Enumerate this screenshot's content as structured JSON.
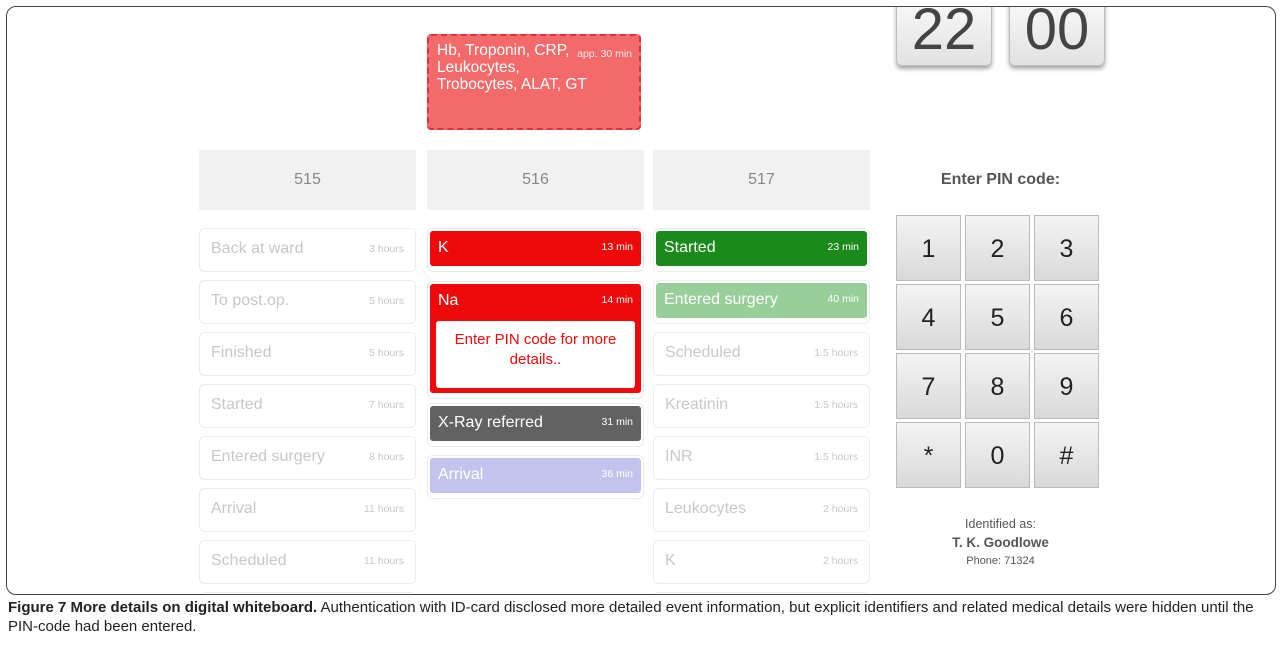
{
  "lab_card": {
    "text": "Hb, Troponin, CRP, Leukocytes, Trobocytes, ALAT, GT",
    "time": "app. 30 min"
  },
  "clock": {
    "digits": [
      "2",
      "2",
      "0",
      "0"
    ]
  },
  "columns": [
    {
      "header": "515",
      "events": [
        {
          "label": "Back at ward",
          "time": "3 hours",
          "style": "faded"
        },
        {
          "label": "To post.op.",
          "time": "5 hours",
          "style": "faded"
        },
        {
          "label": "Finished",
          "time": "5 hours",
          "style": "faded"
        },
        {
          "label": "Started",
          "time": "7 hours",
          "style": "faded"
        },
        {
          "label": "Entered surgery",
          "time": "8 hours",
          "style": "faded"
        },
        {
          "label": "Arrival",
          "time": "11 hours",
          "style": "faded"
        },
        {
          "label": "Scheduled",
          "time": "11 hours",
          "style": "faded"
        }
      ]
    },
    {
      "header": "516",
      "events": [
        {
          "label": "K",
          "time": "13 min",
          "style": "red"
        },
        {
          "label": "Na",
          "time": "14 min",
          "style": "red-expanded",
          "message": "Enter PIN code for more details.."
        },
        {
          "label": "X-Ray referred",
          "time": "31 min",
          "style": "gray"
        },
        {
          "label": "Arrival",
          "time": "36 min",
          "style": "lavender"
        }
      ]
    },
    {
      "header": "517",
      "events": [
        {
          "label": "Started",
          "time": "23 min",
          "style": "green"
        },
        {
          "label": "Entered surgery",
          "time": "40 min",
          "style": "light-green"
        },
        {
          "label": "Scheduled",
          "time": "1.5 hours",
          "style": "faded"
        },
        {
          "label": "Kreatinin",
          "time": "1.5 hours",
          "style": "faded"
        },
        {
          "label": "INR",
          "time": "1.5 hours",
          "style": "faded"
        },
        {
          "label": "Leukocytes",
          "time": "2 hours",
          "style": "faded"
        },
        {
          "label": "K",
          "time": "2 hours",
          "style": "faded"
        }
      ]
    }
  ],
  "pin": {
    "title": "Enter PIN code:",
    "keys": [
      "1",
      "2",
      "3",
      "4",
      "5",
      "6",
      "7",
      "8",
      "9",
      "*",
      "0",
      "#"
    ]
  },
  "identity": {
    "label": "Identified as:",
    "name": "T. K. Goodlowe",
    "phone": "Phone: 71324"
  },
  "caption": {
    "title": "Figure 7 More details on digital whiteboard.",
    "body": " Authentication with ID-card disclosed more detailed event information, but explicit identifiers and related medical details were hidden until the PIN-code had been entered."
  },
  "colors": {
    "red": "#ee0a0a",
    "lab_card": "#f46a6a",
    "green": "#1a8b1a",
    "light_green": "#98cf98",
    "gray": "#626262",
    "lavender": "#c3c4ee"
  }
}
